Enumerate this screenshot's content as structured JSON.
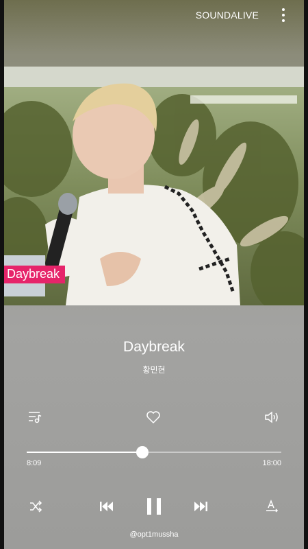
{
  "app": {
    "brand": "SOUNDALIVE"
  },
  "video": {
    "overlay_label": "Daybreak"
  },
  "track": {
    "title": "Daybreak",
    "artist": "황민현"
  },
  "playback": {
    "current_time": "8:09",
    "total_time": "18:00",
    "progress": 0.453,
    "state": "playing"
  },
  "controls": {
    "top_icons": [
      "playlist-icon",
      "heart-icon",
      "volume-icon"
    ],
    "bottom_icons": [
      "shuffle-icon",
      "previous-icon",
      "pause-icon",
      "next-icon",
      "lyrics-icon"
    ]
  },
  "footer": {
    "handle": "@opt1mussha"
  },
  "colors": {
    "accent_tag": "#e6246a",
    "text": "#ffffff"
  }
}
